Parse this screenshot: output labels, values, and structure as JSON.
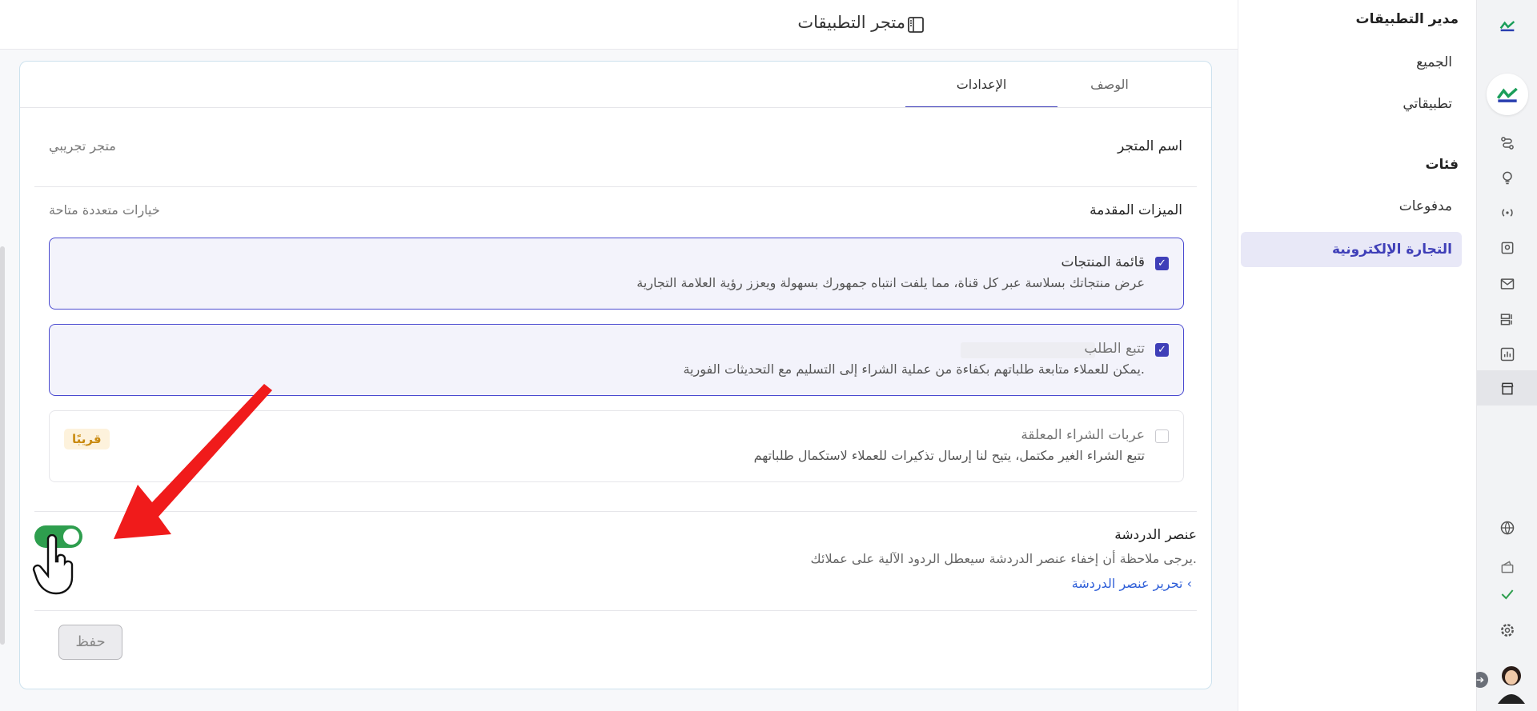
{
  "header": {
    "title": "متجر التطبيقات"
  },
  "sidebar": {
    "title": "مدير التطبيقات",
    "items": [
      "الجميع",
      "تطبيقاتي"
    ],
    "section_title": "فئات",
    "category_items": [
      "مدفوعات",
      "التجارة الإلكترونية"
    ],
    "active_item": "التجارة الإلكترونية"
  },
  "tabs": {
    "description": "الوصف",
    "settings": "الإعدادات"
  },
  "store_name": {
    "label": "اسم المتجر",
    "value": "متجر تجريبي"
  },
  "advanced": {
    "label": "الميزات المقدمة",
    "hint": "خيارات متعددة متاحة",
    "features": [
      {
        "title": "قائمة المنتجات",
        "desc": "عرض منتجاتك بسلاسة عبر كل قناة، مما يلفت انتباه جمهورك بسهولة ويعزز رؤية العلامة التجارية",
        "checked": true
      },
      {
        "title": "تتبع الطلب",
        "desc": "يمكن للعملاء متابعة طلباتهم بكفاءة من عملية الشراء إلى التسليم مع التحديثات الفورية.",
        "checked": true
      },
      {
        "title": "عربات الشراء المعلقة",
        "desc": "تتبع الشراء الغير مكتمل، يتيح لنا إرسال تذكيرات للعملاء لاستكمال طلباتهم",
        "checked": false,
        "badge": "قريبًا"
      }
    ]
  },
  "chat": {
    "label": "عنصر الدردشة",
    "note": "يرجى ملاحظة أن إخفاء عنصر الدردشة سيعطل الردود الآلية على عملائك.",
    "link": "تحرير عنصر الدردشة",
    "enabled": true
  },
  "save_button": "حفظ",
  "colors": {
    "accent": "#3f3fb8",
    "toggle_on": "#2e9e4e",
    "link": "#2f5fd8",
    "badge": "#c98a10"
  }
}
